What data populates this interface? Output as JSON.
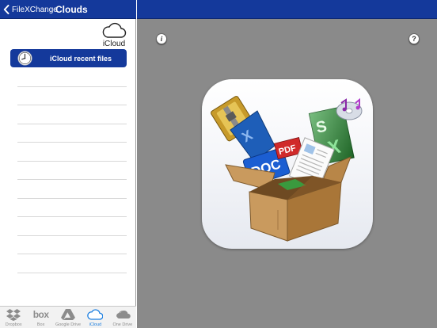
{
  "sidebar": {
    "back_label": "FileXChange",
    "title": "Clouds",
    "provider_logo": {
      "icon": "icloud-icon",
      "text": "iCloud"
    },
    "recent_button_label": "iCloud recent files",
    "file_rows_count": 11,
    "tabs": [
      {
        "label": "Dropbox",
        "icon": "dropbox-icon"
      },
      {
        "label": "Box",
        "icon": "box-icon",
        "logo_text": "box"
      },
      {
        "label": "Google Drive",
        "icon": "google-drive-icon"
      },
      {
        "label": "iCloud",
        "icon": "icloud-icon",
        "active": true
      },
      {
        "label": "One Drive",
        "icon": "onedrive-icon"
      }
    ]
  },
  "main": {
    "info_label": "i",
    "help_label": "?",
    "app_icon": {
      "icon": "filexchange-app-icon",
      "labels": {
        "doc": "DOC",
        "pdf": "PDF",
        "x": "X",
        "s": "S"
      }
    }
  },
  "colors": {
    "header_blue": "#14399b",
    "main_background": "#8a8a8a",
    "active_tab": "#1d7fe0"
  }
}
